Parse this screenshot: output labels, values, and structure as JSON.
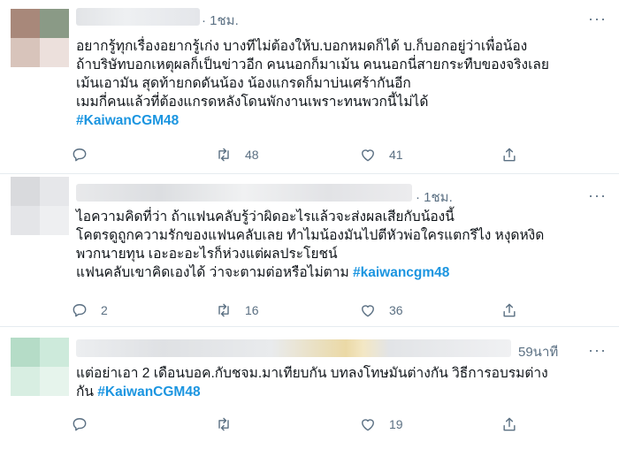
{
  "tweets": [
    {
      "time": "· 1ชม.",
      "lines": [
        "อยากรู้ทุกเรื่องอยากรู้เก่ง บางทีไม่ต้องให้บ.บอกหมดก็ได้ บ.ก็บอกอยู่ว่าเพื่อน้อง",
        "ถ้าบริษัทบอกเหตุผลก็เป็นข่าวอีก คนนอกก็มาเม้น คนนอกนี่สายกระทืบของจริงเลย",
        "เม้นเอามัน สุดท้ายกดดันน้อง น้องแกรดก็มาบ่นเศร้ากันอีก",
        "เมมกี่คนแล้วที่ต้องแกรดหลังโดนพักงานเพราะทนพวกนี้ไม่ได้"
      ],
      "hashtag": "#KaiwanCGM48",
      "reply_count": "",
      "retweet_count": "48",
      "like_count": "41"
    },
    {
      "time": "· 1ชม.",
      "lines": [
        "ไอความคิดที่ว่า ถ้าแฟนคลับรู้ว่าผิดอะไรแล้วจะส่งผลเสียกับน้องนี้",
        "โคตรดูถูกความรักของแฟนคลับเลย ทำไมน้องมันไปตีหัวพ่อใครแตกรึไง หงุดหงิด",
        "พวกนายทุน เอะอะอะไรก็ห่วงแต่ผลประโยชน์"
      ],
      "last_line_prefix": "แฟนคลับเขาคิดเองได้ ว่าจะตามต่อหรือไม่ตาม ",
      "hashtag": "#kaiwancgm48",
      "reply_count": "2",
      "retweet_count": "16",
      "like_count": "36"
    },
    {
      "time": "59นาที",
      "lines": [
        "แต่อย่าเอา 2 เดือนบอค.กับชจม.มาเทียบกัน บทลงโทษมันต่างกัน วิธีการอบรมต่าง"
      ],
      "last_line_prefix": "กัน ",
      "hashtag": "#KaiwanCGM48",
      "reply_count": "",
      "retweet_count": "",
      "like_count": "19"
    }
  ],
  "icons": {
    "reply": "reply-bubble-icon",
    "retweet": "retweet-arrows-icon",
    "like": "heart-icon",
    "share": "share-upload-icon",
    "more": "more-dots-icon"
  },
  "colors": {
    "hashtag": "#1b95e0",
    "muted": "#5b7083",
    "divider": "#e6ecf0"
  }
}
